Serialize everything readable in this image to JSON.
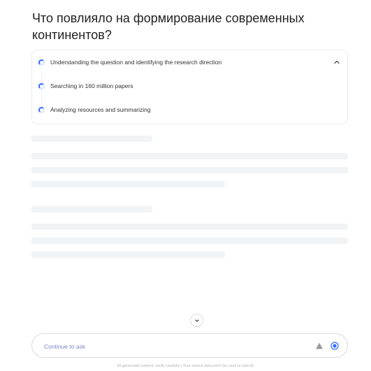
{
  "question": {
    "text": "Что повлияло на формирование современных континентов?"
  },
  "steps": [
    {
      "label": "Understanding the question and identifying the research direction",
      "icon": "spinner-icon"
    },
    {
      "label": "Searching in 160 million papers",
      "icon": "spinner-icon"
    },
    {
      "label": "Analyzing resources and summarizing",
      "icon": "spinner-icon"
    }
  ],
  "steps_panel": {
    "toggle_icon": "chevron-up-icon"
  },
  "scroll_button": {
    "icon": "chevron-down-icon"
  },
  "ask": {
    "placeholder": "Continue to ask",
    "left_icon": "triangle-icon",
    "send_icon": "stop-record-icon"
  },
  "footer": {
    "disclaimer": "AI-generated content, verify carefully | Your search data won't be used to train AI"
  },
  "colors": {
    "accent": "#2f6bff",
    "placeholder": "#7b86c6",
    "skeleton": "#f2f3f5"
  }
}
